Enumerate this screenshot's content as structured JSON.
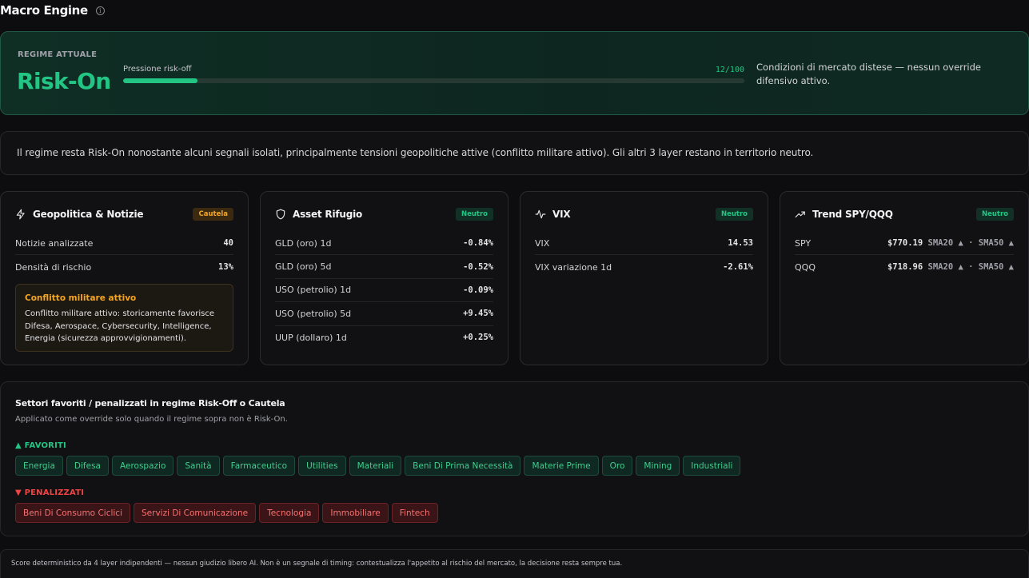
{
  "app": {
    "title": "Macro Engine",
    "info_icon": "info-icon"
  },
  "regime": {
    "label": "REGIME ATTUALE",
    "value": "Risk-On",
    "pressure_label": "Pressione risk-off",
    "pressure_score_text": "12/100",
    "pressure_fraction": 0.12,
    "description": "Condizioni di mercato distese — nessun override difensivo attivo.",
    "accent_color": "#22c583"
  },
  "summary": {
    "text": "Il regime resta Risk-On nonostante alcuni segnali isolati, principalmente tensioni geopolitiche attive (conflitto militare attivo). Gli altri 3 layer restano in territorio neutro."
  },
  "cards": {
    "geo": {
      "title": "Geopolitica & Notizie",
      "icon": "lightning-icon",
      "badge": "Cautela",
      "rows": [
        {
          "label": "Notizie analizzate",
          "value": "40"
        },
        {
          "label": "Densità di rischio",
          "value": "13%"
        }
      ],
      "alert": {
        "title": "Conflitto militare attivo",
        "body": "Conflitto militare attivo: storicamente favorisce Difesa, Aerospace, Cybersecurity, Intelligence, Energia (sicurezza approvvigionamenti)."
      }
    },
    "safe": {
      "title": "Asset Rifugio",
      "icon": "shield-icon",
      "badge": "Neutro",
      "rows": [
        {
          "label": "GLD (oro) 1d",
          "value": "-0.84%"
        },
        {
          "label": "GLD (oro) 5d",
          "value": "-0.52%"
        },
        {
          "label": "USO (petrolio) 1d",
          "value": "-0.09%"
        },
        {
          "label": "USO (petrolio) 5d",
          "value": "+9.45%"
        },
        {
          "label": "UUP (dollaro) 1d",
          "value": "+0.25%"
        }
      ]
    },
    "vix": {
      "title": "VIX",
      "icon": "activity-icon",
      "badge": "Neutro",
      "rows": [
        {
          "label": "VIX",
          "value": "14.53"
        },
        {
          "label": "VIX variazione 1d",
          "value": "-2.61%"
        }
      ]
    },
    "trend": {
      "title": "Trend SPY/QQQ",
      "icon": "trending-up-icon",
      "badge": "Neutro",
      "rows": [
        {
          "label": "SPY",
          "price": "$770.19",
          "sma": "SMA20 ▲ · SMA50 ▲"
        },
        {
          "label": "QQQ",
          "price": "$718.96",
          "sma": "SMA20 ▲ · SMA50 ▲"
        }
      ]
    }
  },
  "sectors": {
    "title": "Settori favoriti / penalizzati in regime Risk-Off o Cautela",
    "subtitle": "Applicato come override solo quando il regime sopra non è Risk-On.",
    "favored_label": "▲ FAVORITI",
    "favored": [
      "Energia",
      "Difesa",
      "Aerospazio",
      "Sanità",
      "Farmaceutico",
      "Utilities",
      "Materiali",
      "Beni Di Prima Necessità",
      "Materie Prime",
      "Oro",
      "Mining",
      "Industriali"
    ],
    "penalized_label": "▼ PENALIZZATI",
    "penalized": [
      "Beni Di Consumo Ciclici",
      "Servizi Di Comunicazione",
      "Tecnologia",
      "Immobiliare",
      "Fintech"
    ]
  },
  "footer": {
    "text": "Score deterministico da 4 layer indipendenti — nessun giudizio libero AI. Non è un segnale di timing: contestualizza l'appetito al rischio del mercato, la decisione resta sempre tua."
  }
}
